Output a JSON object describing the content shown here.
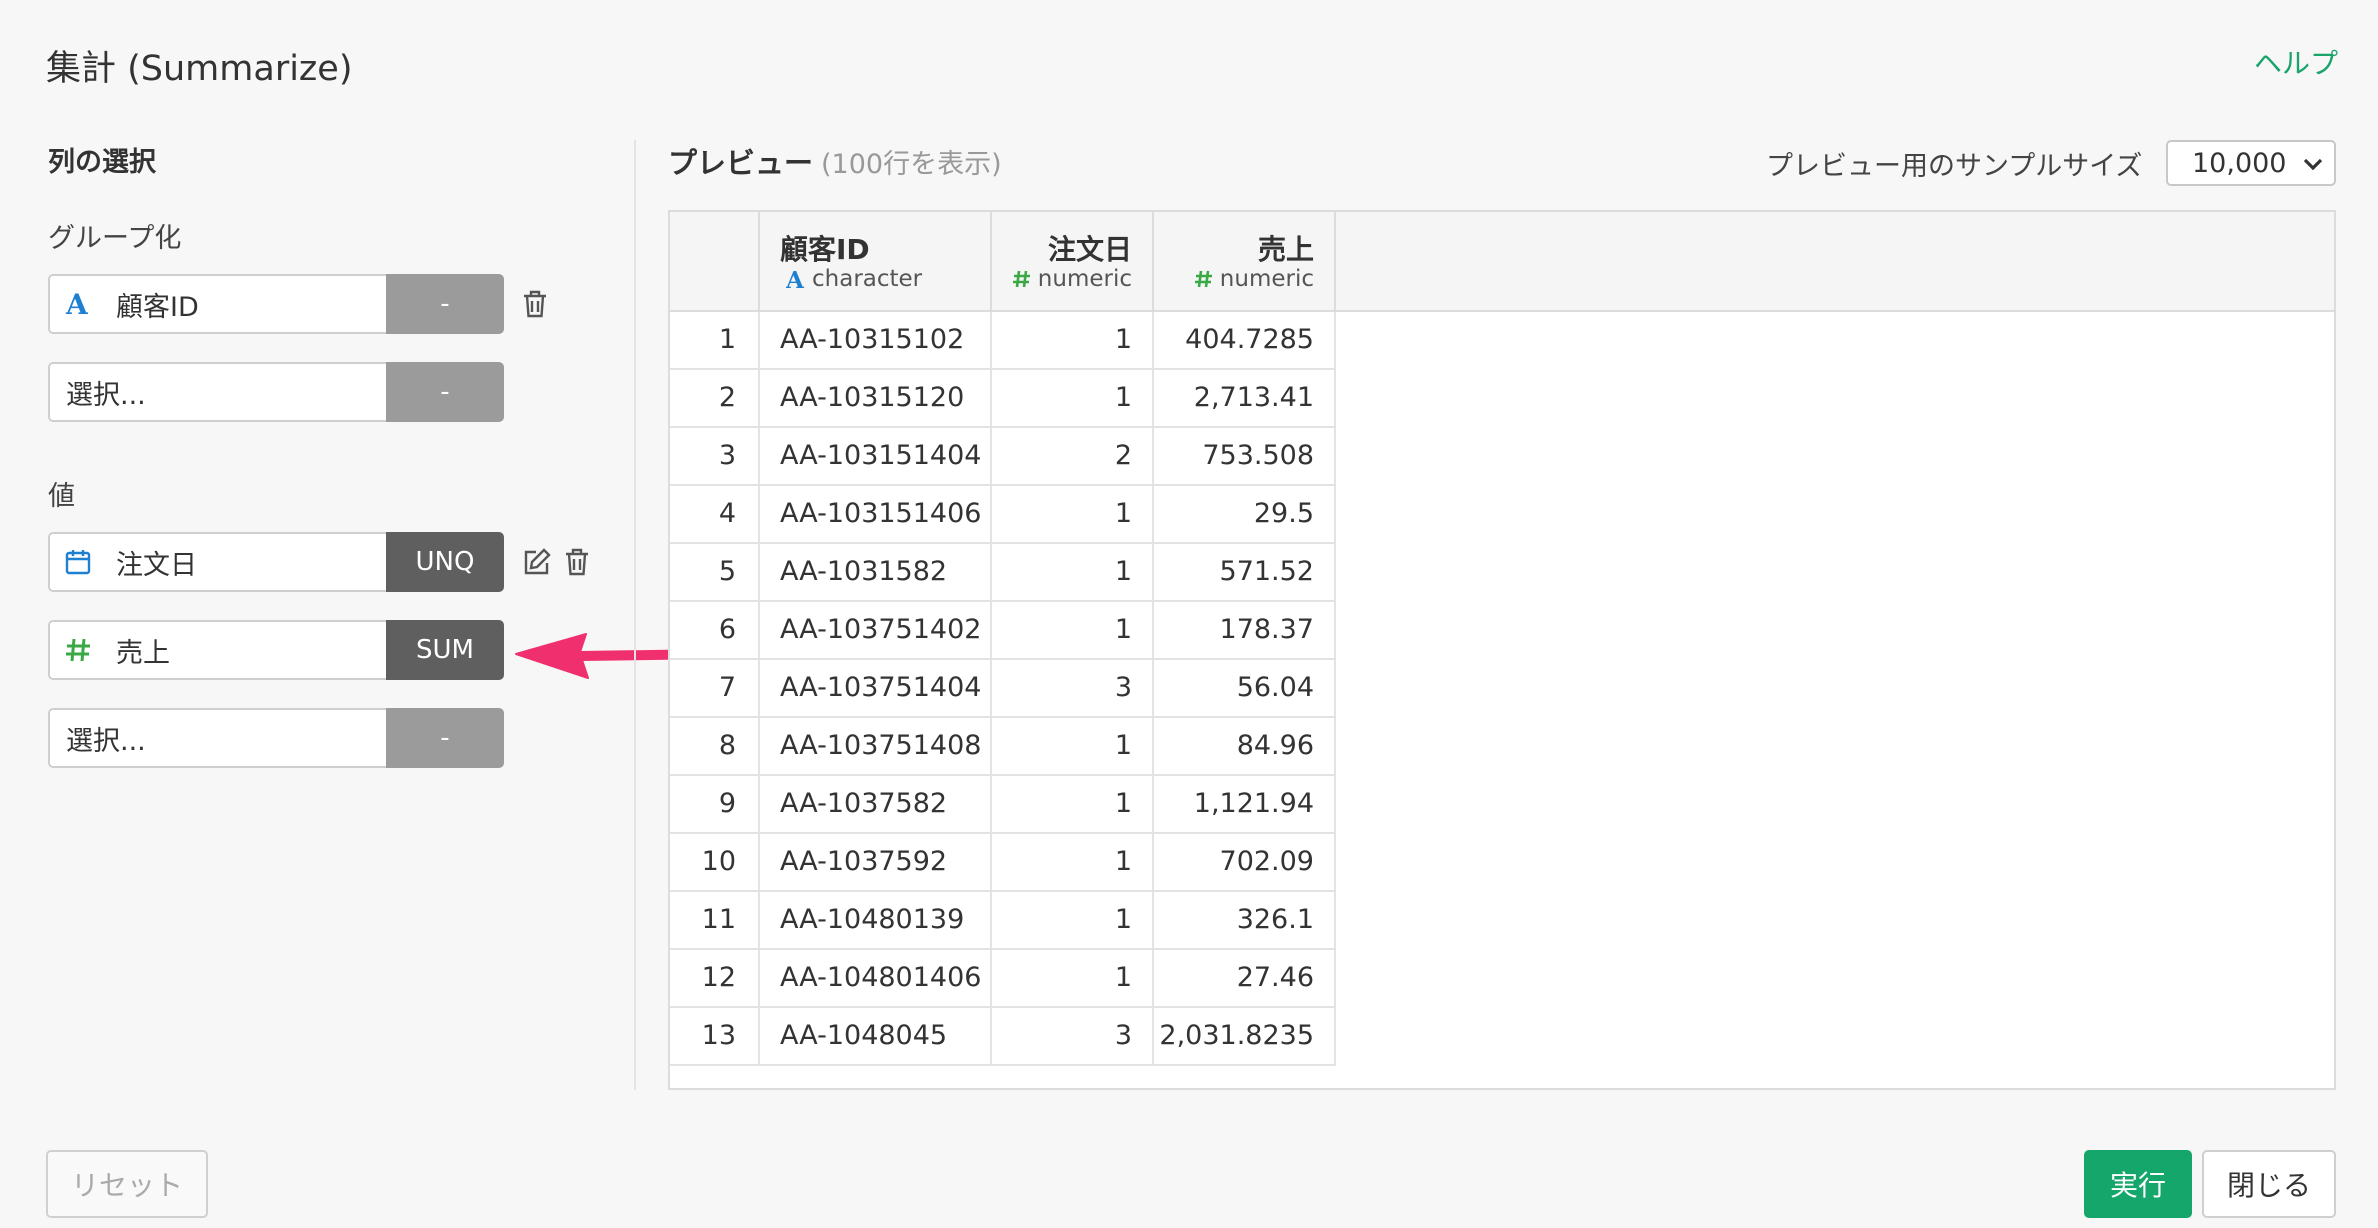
{
  "header": {
    "title": "集計 (Summarize)",
    "help": "ヘルプ"
  },
  "left": {
    "section_title": "列の選択",
    "group_label": "グループ化",
    "value_label": "値",
    "group_rows": [
      {
        "icon": "character-type-icon",
        "name": "顧客ID",
        "agg": "-"
      },
      {
        "placeholder": "選択...",
        "agg": "-"
      }
    ],
    "value_rows": [
      {
        "icon": "calendar-icon",
        "name": "注文日",
        "agg": "UNQ"
      },
      {
        "icon": "numeric-type-icon",
        "name": "売上",
        "agg": "SUM"
      },
      {
        "placeholder": "選択...",
        "agg": "-"
      }
    ]
  },
  "preview": {
    "title": "プレビュー",
    "count": "(100行を表示)",
    "sample_label": "プレビュー用のサンプルサイズ",
    "sample_value": "10,000",
    "columns": [
      {
        "name": "顧客ID",
        "type": "character"
      },
      {
        "name": "注文日",
        "type": "numeric"
      },
      {
        "name": "売上",
        "type": "numeric"
      }
    ],
    "rows": [
      [
        "1",
        "AA-10315102",
        "1",
        "404.7285"
      ],
      [
        "2",
        "AA-10315120",
        "1",
        "2,713.41"
      ],
      [
        "3",
        "AA-103151404",
        "2",
        "753.508"
      ],
      [
        "4",
        "AA-103151406",
        "1",
        "29.5"
      ],
      [
        "5",
        "AA-1031582",
        "1",
        "571.52"
      ],
      [
        "6",
        "AA-103751402",
        "1",
        "178.37"
      ],
      [
        "7",
        "AA-103751404",
        "3",
        "56.04"
      ],
      [
        "8",
        "AA-103751408",
        "1",
        "84.96"
      ],
      [
        "9",
        "AA-1037582",
        "1",
        "1,121.94"
      ],
      [
        "10",
        "AA-1037592",
        "1",
        "702.09"
      ],
      [
        "11",
        "AA-10480139",
        "1",
        "326.1"
      ],
      [
        "12",
        "AA-104801406",
        "1",
        "27.46"
      ],
      [
        "13",
        "AA-1048045",
        "3",
        "2,031.8235"
      ]
    ]
  },
  "footer": {
    "reset": "リセット",
    "run": "実行",
    "close": "閉じる"
  },
  "colors": {
    "accent": "#14a66a",
    "annotation_arrow": "#f0306e",
    "character_icon": "#1f7fd0",
    "numeric_icon": "#3aa845"
  }
}
